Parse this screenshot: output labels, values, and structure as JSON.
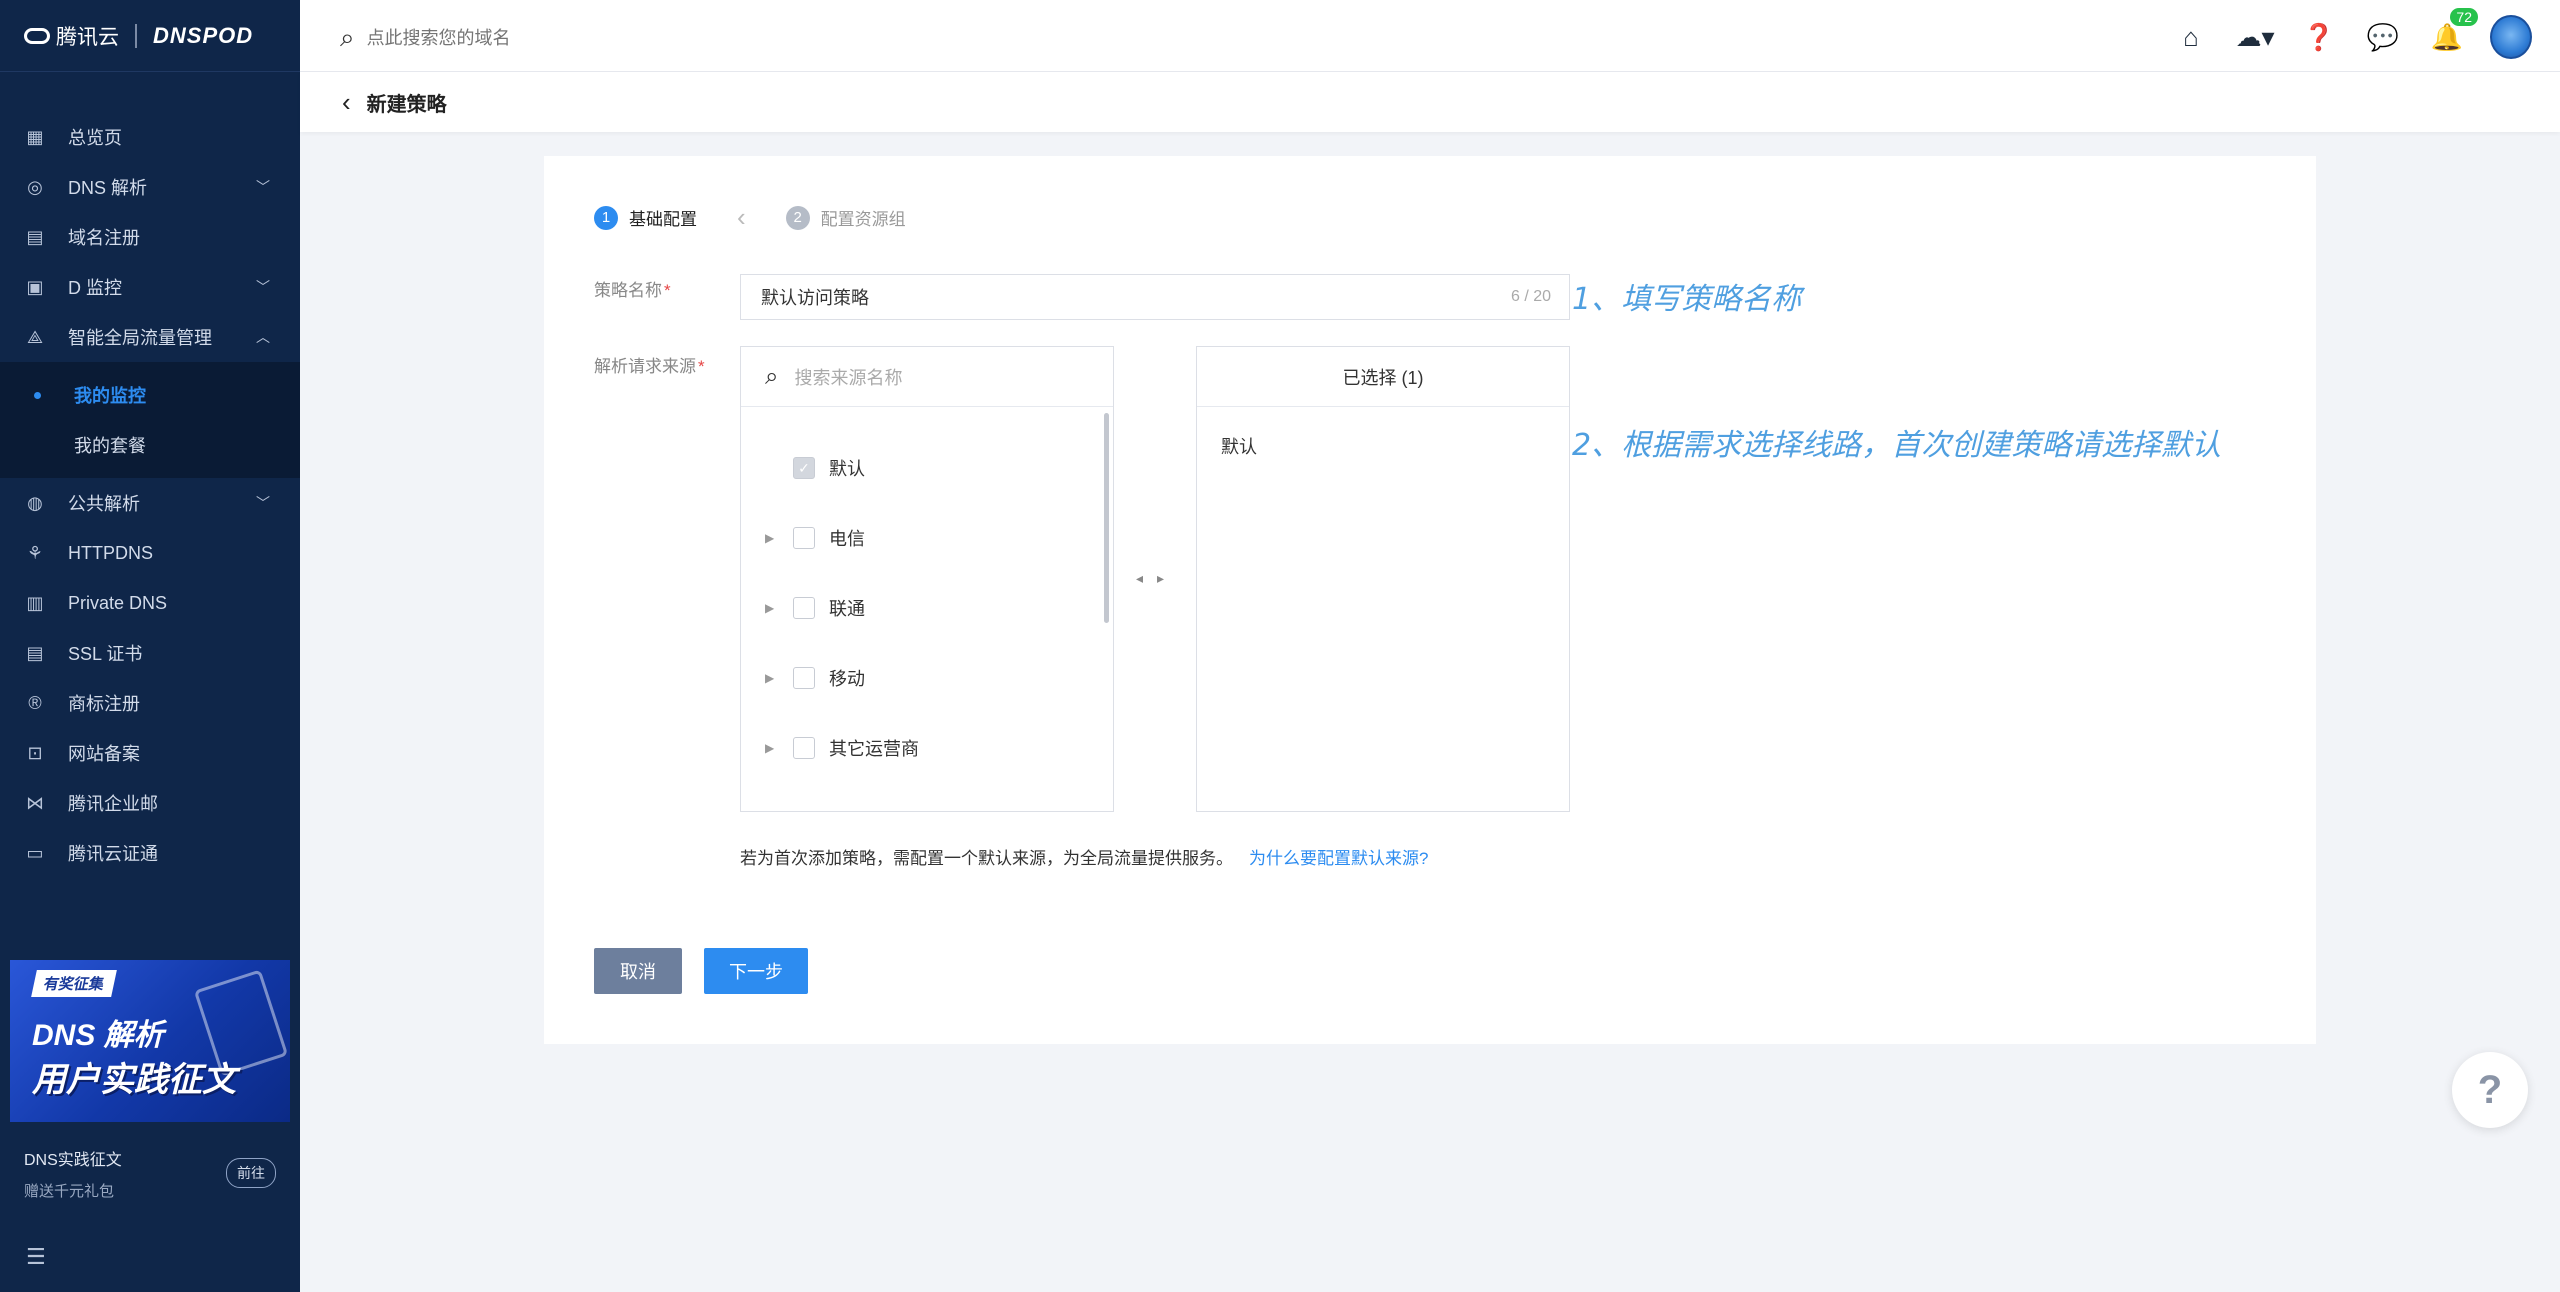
{
  "brand": {
    "logo_text": "腾讯云",
    "product": "DNSPOD"
  },
  "sidebar": {
    "items": [
      {
        "label": "总览页",
        "icon": "grid-icon",
        "chevron": false
      },
      {
        "label": "DNS 解析",
        "icon": "globe-icon",
        "chevron": true
      },
      {
        "label": "域名注册",
        "icon": "card-icon",
        "chevron": false
      },
      {
        "label": "D 监控",
        "icon": "monitor-icon",
        "chevron": true
      },
      {
        "label": "智能全局流量管理",
        "icon": "nodes-icon",
        "chevron": true,
        "expanded": true
      }
    ],
    "sub_items": [
      {
        "label": "我的监控",
        "active": true
      },
      {
        "label": "我的套餐",
        "active": false
      }
    ],
    "items2": [
      {
        "label": "公共解析",
        "icon": "globe-icon",
        "chevron": true
      },
      {
        "label": "HTTPDNS",
        "icon": "share-icon",
        "chevron": false
      },
      {
        "label": "Private DNS",
        "icon": "lock-box-icon",
        "chevron": false
      },
      {
        "label": "SSL 证书",
        "icon": "certificate-icon",
        "chevron": false
      },
      {
        "label": "商标注册",
        "icon": "trademark-icon",
        "chevron": false
      },
      {
        "label": "网站备案",
        "icon": "record-icon",
        "chevron": false
      },
      {
        "label": "腾讯企业邮",
        "icon": "mail-icon",
        "chevron": false
      },
      {
        "label": "腾讯云证通",
        "icon": "id-icon",
        "chevron": false
      }
    ],
    "banner": {
      "tag": "有奖征集",
      "line1": "DNS 解析",
      "line2": "用户实践征文"
    },
    "promo": {
      "title": "DNS实践征文",
      "subtitle": "赠送千元礼包",
      "button": "前往"
    }
  },
  "topbar": {
    "search_placeholder": "点此搜索您的域名",
    "notification_count": "72"
  },
  "subheader": {
    "title": "新建策略"
  },
  "steps": [
    {
      "num": "1",
      "label": "基础配置",
      "active": true
    },
    {
      "num": "2",
      "label": "配置资源组",
      "active": false
    }
  ],
  "form": {
    "name_label": "策略名称",
    "name_value": "默认访问策略",
    "name_count": "6 / 20",
    "source_label": "解析请求来源",
    "source_search_placeholder": "搜索来源名称",
    "source_options": [
      {
        "label": "默认",
        "checked": true,
        "expandable": false
      },
      {
        "label": "电信",
        "checked": false,
        "expandable": true
      },
      {
        "label": "联通",
        "checked": false,
        "expandable": true
      },
      {
        "label": "移动",
        "checked": false,
        "expandable": true
      },
      {
        "label": "其它运营商",
        "checked": false,
        "expandable": true
      }
    ],
    "selected_header": "已选择 (1)",
    "selected_items": [
      "默认"
    ],
    "note": "若为首次添加策略，需配置一个默认来源，为全局流量提供服务。",
    "note_link": "为什么要配置默认来源?",
    "cancel": "取消",
    "next": "下一步"
  },
  "annotations": {
    "a1": "1、填写策略名称",
    "a2": "2、根据需求选择线路，首次创建策略请选择默认"
  },
  "colors": {
    "sidebar_bg": "#0f2649",
    "accent": "#2d8cf0",
    "annotation": "#4f9fe0"
  }
}
